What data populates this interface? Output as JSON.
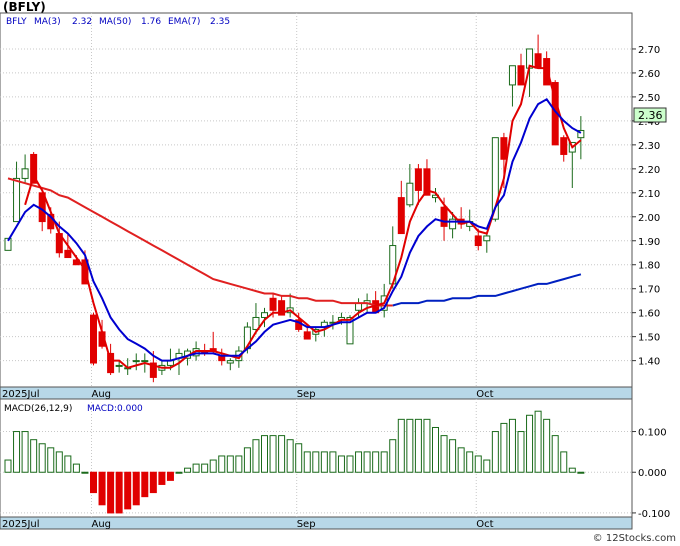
{
  "symbol_title": "(BFLY)",
  "legend": {
    "symbol": "BFLY",
    "ma3_label": "MA(3)",
    "ma3_value": "2.32",
    "ma50_label": "MA(50)",
    "ma50_value": "1.76",
    "ema7_label": "EMA(7)",
    "ema7_value": "2.35"
  },
  "last_price": "2.36",
  "macd_legend": {
    "label": "MACD(26,12,9)",
    "value_label": "MACD:0.000"
  },
  "footer": "© 12Stocks.com",
  "colors": {
    "up": "#1a6a1a",
    "down": "#e00000",
    "ma3": "#e00000",
    "ema7": "#0000d0",
    "ma50": "#e02020",
    "ma50_late": "#0020c0",
    "axis_bg": "#b8d8e8",
    "price_box": "#ccffcc"
  },
  "chart_data": [
    {
      "type": "candlestick",
      "title": "(BFLY)",
      "ylim": [
        1.29,
        2.85
      ],
      "y_ticks": [
        "2.70",
        "2.60",
        "2.50",
        "2.40",
        "2.30",
        "2.20",
        "2.10",
        "2.00",
        "1.90",
        "1.80",
        "1.70",
        "1.60",
        "1.50",
        "1.40"
      ],
      "x_labels": [
        "2025Jul",
        "Aug",
        "Sep",
        "Oct"
      ],
      "candles": [
        [
          1.86,
          1.91,
          1.86,
          1.91
        ],
        [
          1.98,
          2.23,
          1.98,
          2.16
        ],
        [
          2.16,
          2.26,
          2.14,
          2.2
        ],
        [
          2.26,
          2.27,
          2.14,
          2.14
        ],
        [
          2.1,
          2.1,
          1.94,
          1.98
        ],
        [
          2.01,
          2.04,
          1.93,
          1.95
        ],
        [
          1.93,
          1.98,
          1.83,
          1.85
        ],
        [
          1.86,
          1.93,
          1.84,
          1.83
        ],
        [
          1.82,
          1.84,
          1.8,
          1.8
        ],
        [
          1.82,
          1.86,
          1.72,
          1.72
        ],
        [
          1.59,
          1.6,
          1.38,
          1.39
        ],
        [
          1.52,
          1.57,
          1.45,
          1.46
        ],
        [
          1.43,
          1.47,
          1.34,
          1.35
        ],
        [
          1.38,
          1.4,
          1.35,
          1.38
        ],
        [
          1.37,
          1.41,
          1.34,
          1.37
        ],
        [
          1.4,
          1.43,
          1.36,
          1.4
        ],
        [
          1.4,
          1.43,
          1.35,
          1.4
        ],
        [
          1.39,
          1.44,
          1.31,
          1.33
        ],
        [
          1.36,
          1.4,
          1.34,
          1.38
        ],
        [
          1.38,
          1.45,
          1.36,
          1.4
        ],
        [
          1.41,
          1.45,
          1.34,
          1.43
        ],
        [
          1.41,
          1.45,
          1.38,
          1.44
        ],
        [
          1.42,
          1.48,
          1.4,
          1.45
        ],
        [
          1.44,
          1.47,
          1.42,
          1.43
        ],
        [
          1.45,
          1.52,
          1.43,
          1.44
        ],
        [
          1.42,
          1.45,
          1.38,
          1.4
        ],
        [
          1.39,
          1.41,
          1.36,
          1.4
        ],
        [
          1.4,
          1.46,
          1.37,
          1.44
        ],
        [
          1.45,
          1.56,
          1.43,
          1.54
        ],
        [
          1.53,
          1.64,
          1.51,
          1.58
        ],
        [
          1.58,
          1.62,
          1.54,
          1.6
        ],
        [
          1.66,
          1.68,
          1.58,
          1.61
        ],
        [
          1.65,
          1.67,
          1.6,
          1.59
        ],
        [
          1.6,
          1.68,
          1.58,
          1.62
        ],
        [
          1.57,
          1.6,
          1.52,
          1.53
        ],
        [
          1.52,
          1.55,
          1.49,
          1.49
        ],
        [
          1.51,
          1.54,
          1.48,
          1.53
        ],
        [
          1.54,
          1.57,
          1.5,
          1.56
        ],
        [
          1.56,
          1.59,
          1.53,
          1.56
        ],
        [
          1.57,
          1.6,
          1.55,
          1.58
        ],
        [
          1.47,
          1.59,
          1.47,
          1.58
        ],
        [
          1.61,
          1.66,
          1.58,
          1.64
        ],
        [
          1.64,
          1.68,
          1.6,
          1.65
        ],
        [
          1.65,
          1.69,
          1.61,
          1.6
        ],
        [
          1.61,
          1.72,
          1.58,
          1.67
        ],
        [
          1.72,
          1.96,
          1.7,
          1.88
        ],
        [
          2.08,
          2.15,
          1.99,
          1.93
        ],
        [
          2.05,
          2.22,
          2.04,
          2.14
        ],
        [
          2.2,
          2.22,
          2.05,
          2.11
        ],
        [
          2.2,
          2.24,
          2.09,
          2.09
        ],
        [
          2.08,
          2.12,
          2.06,
          2.09
        ],
        [
          2.04,
          2.08,
          1.9,
          1.96
        ],
        [
          1.95,
          2.02,
          1.91,
          1.99
        ],
        [
          1.99,
          2.04,
          1.95,
          1.97
        ],
        [
          1.96,
          2.03,
          1.94,
          1.98
        ],
        [
          1.92,
          1.95,
          1.86,
          1.88
        ],
        [
          1.9,
          1.93,
          1.85,
          1.92
        ],
        [
          1.99,
          2.14,
          1.98,
          2.33
        ],
        [
          2.33,
          2.35,
          2.12,
          2.24
        ],
        [
          2.55,
          2.63,
          2.46,
          2.63
        ],
        [
          2.63,
          2.68,
          2.55,
          2.55
        ],
        [
          2.62,
          2.67,
          2.5,
          2.7
        ],
        [
          2.68,
          2.76,
          2.62,
          2.62
        ],
        [
          2.66,
          2.69,
          2.55,
          2.55
        ],
        [
          2.56,
          2.57,
          2.3,
          2.3
        ],
        [
          2.33,
          2.34,
          2.23,
          2.26
        ],
        [
          2.27,
          2.3,
          2.12,
          2.31
        ],
        [
          2.33,
          2.42,
          2.24,
          2.36
        ]
      ],
      "series": [
        {
          "name": "MA(3)",
          "values": [
            null,
            null,
            2.05,
            2.17,
            2.11,
            2.02,
            1.93,
            1.88,
            1.83,
            1.78,
            1.64,
            1.52,
            1.4,
            1.4,
            1.37,
            1.38,
            1.39,
            1.38,
            1.37,
            1.37,
            1.39,
            1.42,
            1.44,
            1.44,
            1.44,
            1.43,
            1.42,
            1.41,
            1.46,
            1.52,
            1.57,
            1.6,
            1.6,
            1.61,
            1.58,
            1.55,
            1.52,
            1.53,
            1.55,
            1.57,
            1.57,
            1.6,
            1.62,
            1.63,
            1.64,
            1.72,
            1.83,
            1.98,
            2.06,
            2.11,
            2.1,
            2.05,
            2.01,
            1.97,
            1.98,
            1.94,
            1.93,
            2.04,
            2.16,
            2.4,
            2.47,
            2.63,
            2.62,
            2.62,
            2.49,
            2.37,
            2.29,
            2.32
          ]
        },
        {
          "name": "EMA(7)",
          "values": [
            1.9,
            1.96,
            2.02,
            2.05,
            2.03,
            2.0,
            1.96,
            1.93,
            1.89,
            1.84,
            1.73,
            1.66,
            1.58,
            1.53,
            1.49,
            1.47,
            1.45,
            1.42,
            1.4,
            1.4,
            1.41,
            1.42,
            1.43,
            1.43,
            1.43,
            1.42,
            1.42,
            1.42,
            1.45,
            1.48,
            1.52,
            1.55,
            1.56,
            1.57,
            1.56,
            1.54,
            1.54,
            1.54,
            1.55,
            1.56,
            1.56,
            1.58,
            1.6,
            1.6,
            1.62,
            1.69,
            1.75,
            1.85,
            1.92,
            1.96,
            1.99,
            1.98,
            1.98,
            1.98,
            1.98,
            1.96,
            1.95,
            2.04,
            2.09,
            2.23,
            2.31,
            2.41,
            2.47,
            2.49,
            2.44,
            2.4,
            2.37,
            2.35
          ]
        },
        {
          "name": "MA(50)",
          "values": [
            2.16,
            2.15,
            2.14,
            2.13,
            2.12,
            2.11,
            2.09,
            2.08,
            2.06,
            2.04,
            2.02,
            2.0,
            1.98,
            1.96,
            1.94,
            1.92,
            1.9,
            1.88,
            1.86,
            1.84,
            1.82,
            1.8,
            1.78,
            1.76,
            1.74,
            1.73,
            1.72,
            1.71,
            1.7,
            1.69,
            1.68,
            1.68,
            1.67,
            1.67,
            1.66,
            1.66,
            1.65,
            1.65,
            1.65,
            1.64,
            1.64,
            1.64,
            1.64,
            1.63,
            1.63,
            1.63,
            1.64,
            1.64,
            1.64,
            1.65,
            1.65,
            1.65,
            1.66,
            1.66,
            1.66,
            1.67,
            1.67,
            1.67,
            1.68,
            1.69,
            1.7,
            1.71,
            1.72,
            1.72,
            1.73,
            1.74,
            1.75,
            1.76
          ]
        }
      ]
    },
    {
      "type": "bar",
      "title": "MACD(26,12,9)",
      "ylim": [
        -0.11,
        0.18
      ],
      "y_ticks": [
        "0.100",
        "0.000",
        "-0.100"
      ],
      "x_labels": [
        "2025Jul",
        "Aug",
        "Sep",
        "Oct"
      ],
      "values": [
        0.03,
        0.1,
        0.1,
        0.08,
        0.07,
        0.06,
        0.05,
        0.04,
        0.02,
        0.0,
        -0.05,
        -0.08,
        -0.1,
        -0.1,
        -0.09,
        -0.08,
        -0.06,
        -0.05,
        -0.03,
        -0.02,
        0.0,
        0.01,
        0.02,
        0.02,
        0.03,
        0.04,
        0.04,
        0.04,
        0.06,
        0.08,
        0.09,
        0.09,
        0.09,
        0.08,
        0.07,
        0.05,
        0.05,
        0.05,
        0.05,
        0.04,
        0.04,
        0.05,
        0.05,
        0.05,
        0.05,
        0.08,
        0.13,
        0.13,
        0.13,
        0.13,
        0.11,
        0.09,
        0.08,
        0.06,
        0.05,
        0.04,
        0.03,
        0.1,
        0.12,
        0.13,
        0.1,
        0.14,
        0.15,
        0.13,
        0.09,
        0.05,
        0.01,
        0.0
      ]
    }
  ]
}
